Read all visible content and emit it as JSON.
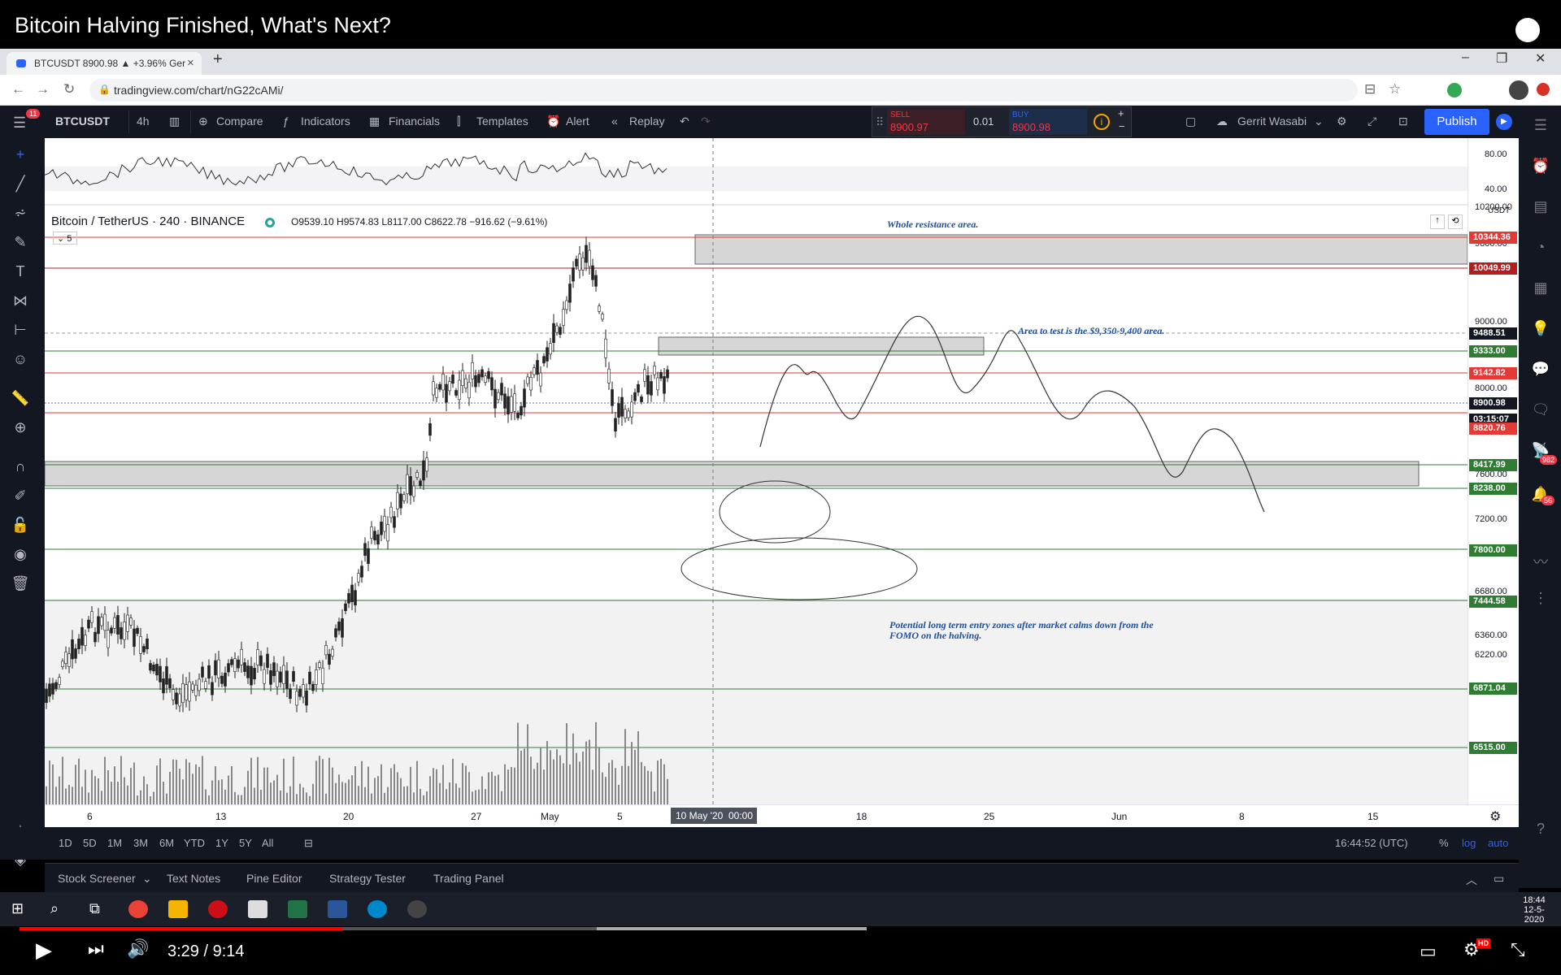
{
  "youtube": {
    "video_title": "Bitcoin Halving Finished, What's Next?",
    "time_current": "3:29",
    "time_sep": "/",
    "time_total": "9:14",
    "hd_badge": "HD",
    "progress_fraction": 0.382
  },
  "browser": {
    "tab_title": "BTCUSDT 8900.98 ▲ +3.96% Ger",
    "url": "tradingview.com/chart/nG22cAMi/",
    "new_tab": "+",
    "tab_close": "×"
  },
  "tv_toolbar": {
    "badge_count": "11",
    "symbol": "BTCUSDT",
    "interval": "4h",
    "compare": "Compare",
    "indicators": "Indicators",
    "financials": "Financials",
    "templates": "Templates",
    "alert": "Alert",
    "replay": "Replay",
    "sell_label": "SELL",
    "sell_price": "8900.97",
    "spread": "0.01",
    "buy_label": "BUY",
    "buy_price": "8900.98",
    "user": "Gerrit Wasabi",
    "publish": "Publish"
  },
  "chart_header": {
    "instrument": "Bitcoin / TetherUS · 240 · BINANCE",
    "ohlc": "O9539.10 H9574.83 L8117.00 C8622.78 −916.62 (−9.61%)",
    "indicator_count": "5",
    "currency": "USDT"
  },
  "rsi_axis": [
    "80.00",
    "40.00"
  ],
  "annotations": {
    "resistance": "Whole resistance area.",
    "test_area": "Area to test is the $9,350-9,400 area.",
    "entry_zones": "Potential long term entry zones after market calms down from the FOMO on the halving."
  },
  "price_axis_labels": [
    "10200.00",
    "9800.00",
    "9000.00",
    "8000.00",
    "7600.00",
    "7200.00",
    "7000.00",
    "6680.00",
    "6360.00",
    "6220.00"
  ],
  "price_badges": [
    {
      "value": "10344.36",
      "color": "#e53935"
    },
    {
      "value": "10049.99",
      "color": "#b71c1c"
    },
    {
      "value": "9488.51",
      "color": "#131722"
    },
    {
      "value": "9333.00",
      "color": "#2e7d32"
    },
    {
      "value": "9142.82",
      "color": "#e53935"
    },
    {
      "value": "8900.98",
      "color": "#131722"
    },
    {
      "value": "03:15:07",
      "color": "#131722"
    },
    {
      "value": "8820.76",
      "color": "#e53935"
    },
    {
      "value": "8417.99",
      "color": "#2e7d32"
    },
    {
      "value": "8238.00",
      "color": "#2e7d32"
    },
    {
      "value": "7800.00",
      "color": "#2e7d32"
    },
    {
      "value": "7444.58",
      "color": "#2e7d32"
    },
    {
      "value": "6871.04",
      "color": "#2e7d32"
    },
    {
      "value": "6515.00",
      "color": "#2e7d32"
    }
  ],
  "time_axis": [
    "6",
    "13",
    "20",
    "27",
    "May",
    "5",
    "18",
    "25",
    "Jun",
    "8",
    "15"
  ],
  "crosshair_time": "10 May '20",
  "crosshair_time2": "00:00",
  "ranges": [
    "1D",
    "5D",
    "1M",
    "3M",
    "6M",
    "YTD",
    "1Y",
    "5Y",
    "All"
  ],
  "bottom_right": {
    "clock": "16:44:52 (UTC)",
    "pct": "%",
    "log": "log",
    "auto": "auto"
  },
  "panels": [
    "Stock Screener",
    "Text Notes",
    "Pine Editor",
    "Strategy Tester",
    "Trading Panel"
  ],
  "taskbar": {
    "time": "18:44",
    "date": "12-5-2020"
  },
  "right_badges": {
    "chat": "982",
    "alerts": "56"
  }
}
